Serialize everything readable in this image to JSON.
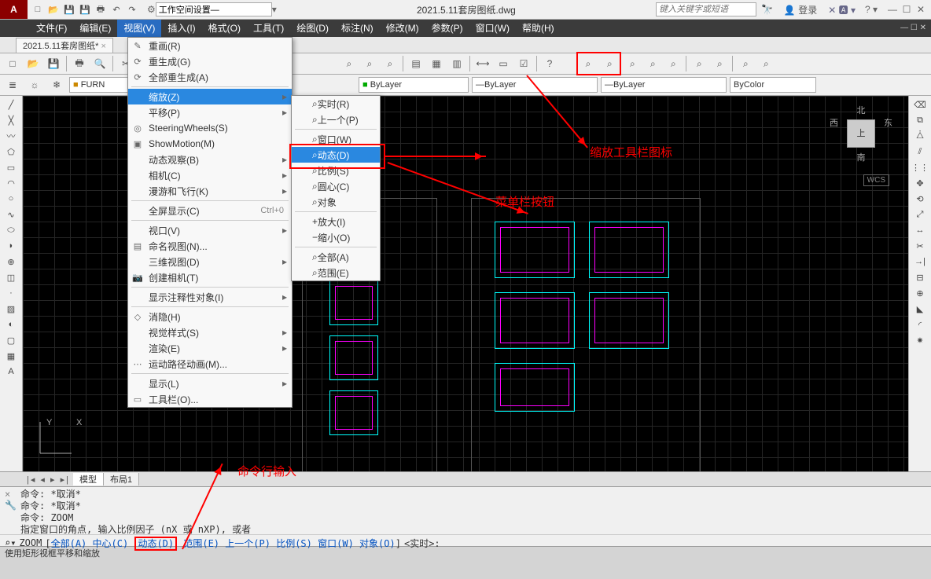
{
  "title": "2021.5.11套房图纸.dwg",
  "workspace_text": "工作空间设置—",
  "search_placeholder": "键入关键字或短语",
  "login": "登录",
  "menubar": [
    "文件(F)",
    "编辑(E)",
    "视图(V)",
    "插入(I)",
    "格式(O)",
    "工具(T)",
    "绘图(D)",
    "标注(N)",
    "修改(M)",
    "参数(P)",
    "窗口(W)",
    "帮助(H)"
  ],
  "doc_tab": "2021.5.11套房图纸*",
  "layer_name": "FURN",
  "bylayer": "ByLayer",
  "bycolor": "ByColor",
  "view_menu": [
    {
      "label": "重画(R)",
      "icon": "✎"
    },
    {
      "label": "重生成(G)",
      "icon": "⟳"
    },
    {
      "label": "全部重生成(A)",
      "icon": "⟳"
    },
    {
      "sep": true
    },
    {
      "label": "缩放(Z)",
      "arrow": true,
      "hl": true
    },
    {
      "label": "平移(P)",
      "arrow": true
    },
    {
      "label": "SteeringWheels(S)",
      "icon": "◎"
    },
    {
      "label": "ShowMotion(M)",
      "icon": "▣"
    },
    {
      "label": "动态观察(B)",
      "arrow": true
    },
    {
      "label": "相机(C)",
      "arrow": true
    },
    {
      "label": "漫游和飞行(K)",
      "arrow": true
    },
    {
      "sep": true
    },
    {
      "label": "全屏显示(C)",
      "sc": "Ctrl+0"
    },
    {
      "sep": true
    },
    {
      "label": "视口(V)",
      "arrow": true
    },
    {
      "label": "命名视图(N)...",
      "icon": "▤"
    },
    {
      "label": "三维视图(D)",
      "arrow": true
    },
    {
      "label": "创建相机(T)",
      "icon": "📷"
    },
    {
      "sep": true
    },
    {
      "label": "显示注释性对象(I)",
      "arrow": true
    },
    {
      "sep": true
    },
    {
      "label": "消隐(H)",
      "icon": "◇"
    },
    {
      "label": "视觉样式(S)",
      "arrow": true
    },
    {
      "label": "渲染(E)",
      "arrow": true
    },
    {
      "label": "运动路径动画(M)...",
      "icon": "⋯"
    },
    {
      "sep": true
    },
    {
      "label": "显示(L)",
      "arrow": true
    },
    {
      "label": "工具栏(O)...",
      "icon": "▭"
    }
  ],
  "zoom_menu": [
    {
      "label": "实时(R)",
      "icon": "⌕"
    },
    {
      "label": "上一个(P)",
      "icon": "⌕"
    },
    {
      "sep": true
    },
    {
      "label": "窗口(W)",
      "icon": "⌕"
    },
    {
      "label": "动态(D)",
      "icon": "⌕",
      "hl": true
    },
    {
      "label": "比例(S)",
      "icon": "⌕"
    },
    {
      "label": "圆心(C)",
      "icon": "⌕"
    },
    {
      "label": "对象",
      "icon": "⌕"
    },
    {
      "sep": true
    },
    {
      "label": "放大(I)",
      "icon": "+"
    },
    {
      "label": "缩小(O)",
      "icon": "−"
    },
    {
      "sep": true
    },
    {
      "label": "全部(A)",
      "icon": "⌕"
    },
    {
      "label": "范围(E)",
      "icon": "⌕"
    }
  ],
  "annotations": {
    "toolbar": "缩放工具栏图标",
    "menu": "菜单栏按钮",
    "cmdline": "命令行输入"
  },
  "viewcube": {
    "n": "北",
    "s": "南",
    "e": "东",
    "w": "西",
    "top": "上",
    "wcs": "WCS"
  },
  "layout_tabs": {
    "model": "模型",
    "layout1": "布局1"
  },
  "cmd_history": [
    "命令: *取消*",
    "命令: *取消*",
    "命令: ZOOM",
    "指定窗口的角点, 输入比例因子 (nX 或 nXP), 或者"
  ],
  "cmd_line": {
    "prefix": "ZOOM",
    "options": [
      "全部(A)",
      "中心(C)",
      "动态(D)",
      "范围(E)",
      "上一个(P)",
      "比例(S)",
      "窗口(W)",
      "对象(O)"
    ],
    "suffix": "<实时>:"
  },
  "statusbar": "使用矩形视框平移和缩放",
  "ucs_y": "Y",
  "ucs_x": "X"
}
